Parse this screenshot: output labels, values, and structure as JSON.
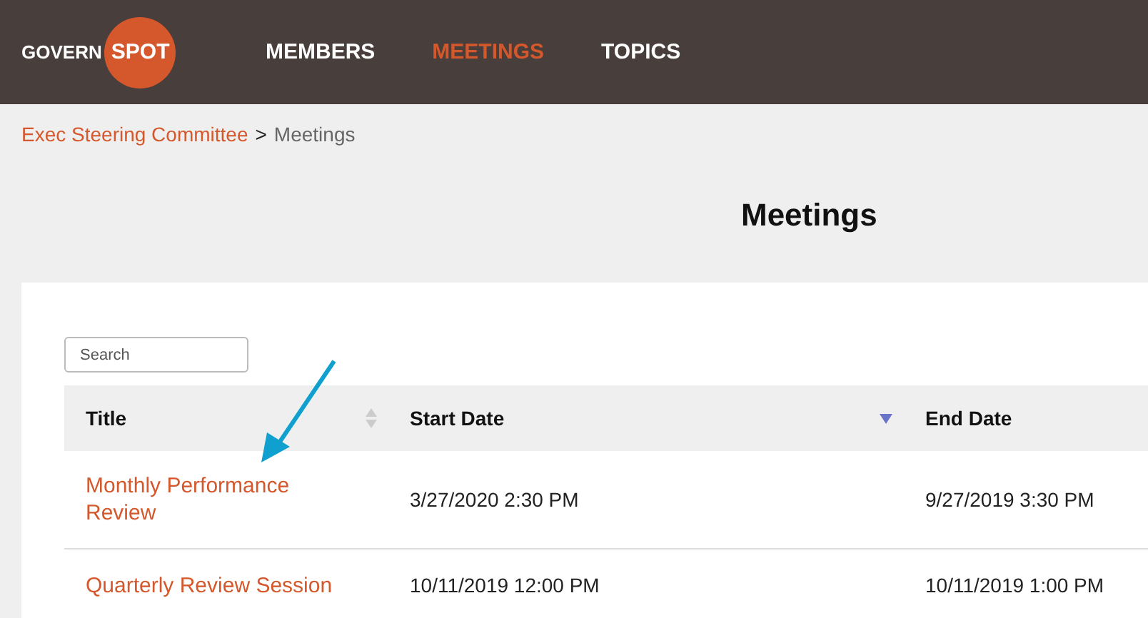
{
  "header": {
    "logo": {
      "word": "GOVERN",
      "badge": "SPOT"
    },
    "nav": [
      {
        "label": "MEMBERS",
        "selected": false
      },
      {
        "label": "MEETINGS",
        "selected": true
      },
      {
        "label": "TOPICS",
        "selected": false
      }
    ]
  },
  "breadcrumb": {
    "parent": "Exec Steering Committee",
    "separator": ">",
    "current": "Meetings"
  },
  "page_title": "Meetings",
  "search": {
    "placeholder": "Search"
  },
  "table": {
    "columns": [
      {
        "label": "Title",
        "sortable": true,
        "sorted": false
      },
      {
        "label": "Start Date",
        "sortable": true,
        "sorted": true
      },
      {
        "label": "End Date",
        "sortable": false,
        "sorted": false
      }
    ],
    "rows": [
      {
        "title": "Monthly Performance Review",
        "start": "3/27/2020 2:30 PM",
        "end": "9/27/2019 3:30 PM"
      },
      {
        "title": "Quarterly Review Session",
        "start": "10/11/2019 12:00 PM",
        "end": "10/11/2019 1:00 PM"
      }
    ]
  }
}
